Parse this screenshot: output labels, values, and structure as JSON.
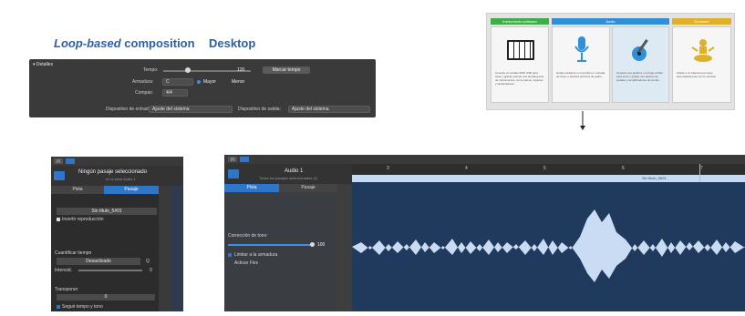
{
  "headings": {
    "loop_bold_italic": "Loop-based",
    "loop_rest": " composition",
    "desktop": "Desktop"
  },
  "details": {
    "title": "▾ Detalles",
    "tempo_label": "Tempo:",
    "tempo_value": "120",
    "count_in_button": "Marcar tempo",
    "key_label": "Armadura:",
    "key_value": "C",
    "major_label": "Mayor",
    "minor_label": "Menor",
    "time_sig_label": "Compás:",
    "time_sig_value": "4/4",
    "input_label": "Dispositivo de entrada:",
    "input_value": "Ajuste del sistema",
    "output_label": "Dispositivo de salida:",
    "output_value": "Ajuste del sistema"
  },
  "chooser": {
    "cards": [
      {
        "header": "Instrumento software",
        "color": "#3fae49",
        "text": "Conecte un teclado MIDI USB para tocar y grabar usando una amplia gama de instrumentos, como pianos, órganos y sintetizadores.",
        "icon": "piano-icon"
      },
      {
        "header": "Audio",
        "color": "#2f8fd8",
        "text": "Graba mediante un micrófono o entrada de línea, o arrastra archivos de audio.",
        "icon": "microphone-icon"
      },
      {
        "header": "",
        "color": "#2f8fd8",
        "text": "Conecte una guitarra o un bajo al Mac para tocar y grabar con efectos de pedales y amplificadores de sonido.",
        "icon": "guitar-icon"
      },
      {
        "header": "Drummer",
        "color": "#e0b02a",
        "text": "Añade a un batería que toque automáticamente con tu canción.",
        "icon": "drums-icon"
      }
    ]
  },
  "left_inspector": {
    "title": "Ningún pasaje seleccionado",
    "subtitle": "en la pista Audio 1",
    "tab_track": "Pista",
    "tab_region": "Pasaje",
    "region_name": "Sin título_5#01",
    "reverse_label": "Invertir reproducción",
    "quantize_label": "Cuantificar tiempo",
    "quantize_value": "Desactivado",
    "quantize_q": "Q",
    "intensity_label": "Intensid.",
    "intensity_value": "0",
    "transpose_label": "Transponer",
    "transpose_value": "0",
    "follow_label": "Seguir tempo y tono"
  },
  "editor": {
    "track_title": "Audio 1",
    "track_subtitle": "Todos los pasajes seleccionados (1)",
    "tab_track": "Pista",
    "tab_region": "Pasaje",
    "pitch_label": "Corrección de tono:",
    "pitch_value": "100",
    "limit_label": "Limitar a la armadura",
    "flex_label": "Activar Flex",
    "ruler": [
      "3",
      "4",
      "5",
      "6",
      "7"
    ],
    "region_label": "Sin título_5#01"
  }
}
